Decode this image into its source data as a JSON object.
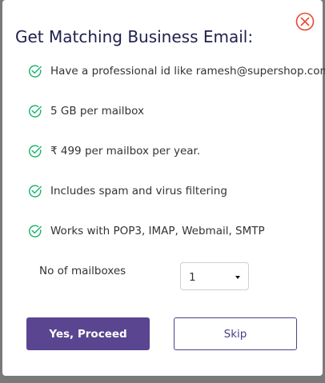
{
  "dialog": {
    "title": "Get Matching Business Email:",
    "features": [
      "Have a professional id like ramesh@supershop.com",
      "5 GB per mailbox",
      "₹ 499 per mailbox per year.",
      "Includes spam and virus filtering",
      "Works with POP3, IMAP, Webmail, SMTP"
    ],
    "mailboxes_label": "No of mailboxes",
    "mailboxes_selected": "1",
    "proceed_label": "Yes, Proceed",
    "skip_label": "Skip"
  },
  "icons": {
    "close": "close-circle-icon",
    "feature_check": "check-circle-icon"
  },
  "colors": {
    "accent": "#5a4590",
    "check": "#22b573",
    "close": "#e8472f",
    "title": "#1f1f4d"
  }
}
